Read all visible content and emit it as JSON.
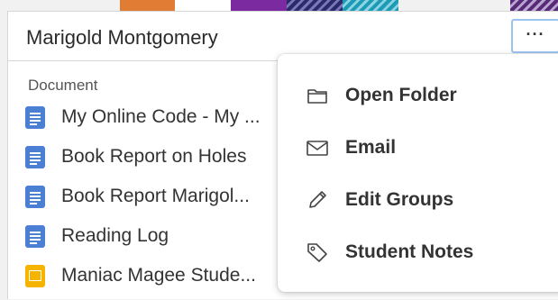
{
  "card": {
    "student_name": "Marigold Montgomery",
    "more_label": "···"
  },
  "documents": {
    "section_label": "Document",
    "items": [
      {
        "title": "My Online Code - My ...",
        "icon": "google-docs-icon"
      },
      {
        "title": "Book Report on Holes",
        "icon": "google-docs-icon"
      },
      {
        "title": "Book Report Marigol...",
        "icon": "google-docs-icon"
      },
      {
        "title": "Reading Log",
        "icon": "google-docs-icon"
      },
      {
        "title": "Maniac Magee Stude...",
        "icon": "google-slides-icon"
      }
    ]
  },
  "menu": {
    "items": [
      {
        "label": "Open Folder",
        "icon": "folder-icon"
      },
      {
        "label": "Email",
        "icon": "envelope-icon"
      },
      {
        "label": "Edit Groups",
        "icon": "pencil-icon"
      },
      {
        "label": "Student Notes",
        "icon": "tag-icon"
      }
    ]
  },
  "colors": {
    "docs_blue": "#4a7fd3",
    "slides_yellow": "#f4b400",
    "focus_ring": "#9cc4ef"
  }
}
